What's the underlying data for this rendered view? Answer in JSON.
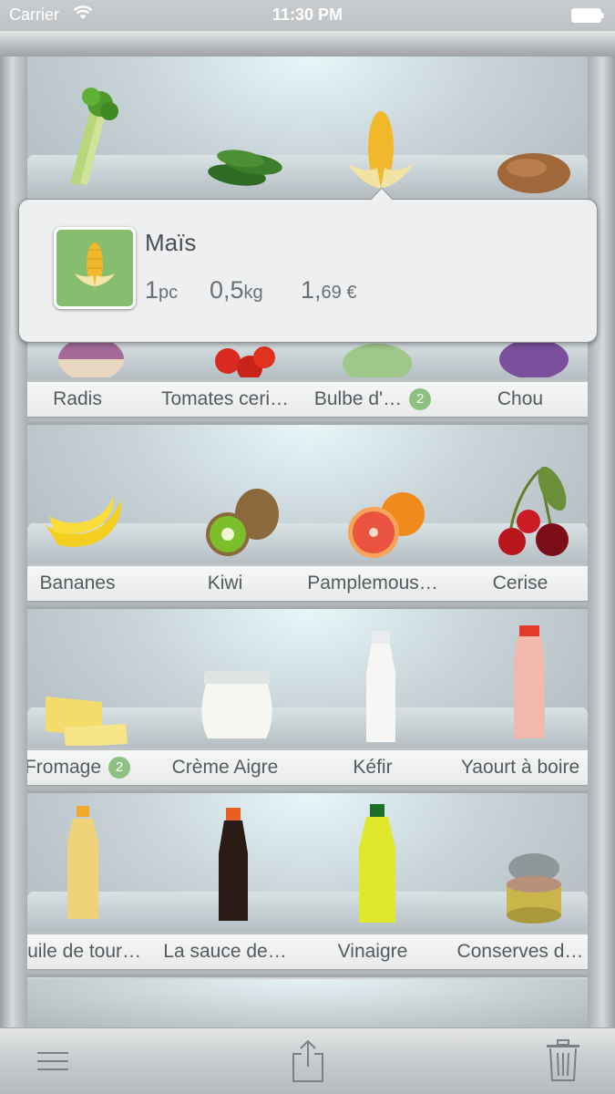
{
  "status_bar": {
    "carrier": "Carrier",
    "time": "11:30 PM"
  },
  "shelves": [
    {
      "items": [
        {
          "name": "Céleri",
          "icon": "celery-icon"
        },
        {
          "name": "Concombre",
          "icon": "cucumber-icon"
        },
        {
          "name": "Maïs",
          "icon": "corn-icon"
        },
        {
          "name": "Pomme de terre",
          "icon": "potato-icon"
        }
      ],
      "show_labels": false
    },
    {
      "items": [
        {
          "name": "Radis",
          "icon": "turnip-icon"
        },
        {
          "name": "Tomates ceri…",
          "icon": "cherry-tomato-icon"
        },
        {
          "name": "Bulbe d'…",
          "icon": "cabbage-icon",
          "badge": "2"
        },
        {
          "name": "Chou",
          "icon": "red-cabbage-icon"
        }
      ]
    },
    {
      "items": [
        {
          "name": "Bananes",
          "icon": "banana-icon"
        },
        {
          "name": "Kiwi",
          "icon": "kiwi-icon"
        },
        {
          "name": "Pamplemous…",
          "icon": "grapefruit-icon"
        },
        {
          "name": "Cerise",
          "icon": "cherry-icon"
        }
      ]
    },
    {
      "items": [
        {
          "name": "Fromage",
          "icon": "cheese-icon",
          "badge": "2"
        },
        {
          "name": "Crème Aigre",
          "icon": "sour-cream-jar-icon"
        },
        {
          "name": "Kéfir",
          "icon": "kefir-bottle-icon"
        },
        {
          "name": "Yaourt à boire",
          "icon": "yogurt-drink-icon"
        }
      ]
    },
    {
      "items": [
        {
          "name": "Huile de tour…",
          "icon": "oil-bottle-icon"
        },
        {
          "name": "La sauce de…",
          "icon": "soy-sauce-icon"
        },
        {
          "name": "Vinaigre",
          "icon": "vinegar-bottle-icon"
        },
        {
          "name": "Conserves d…",
          "icon": "tin-can-icon"
        }
      ]
    }
  ],
  "popover": {
    "title": "Maïs",
    "quantity": {
      "value": "1",
      "unit": "pc"
    },
    "weight": {
      "value": "0,5",
      "unit": "kg"
    },
    "price": {
      "value": "1,",
      "rest": "69 €"
    }
  },
  "toolbar": {
    "menu_icon": "hamburger-menu-icon",
    "share_icon": "share-icon",
    "delete_icon": "trash-icon"
  },
  "colors": {
    "badge": "#8cc181",
    "thumb_bg": "#86bd6f",
    "text": "#555a5e"
  }
}
